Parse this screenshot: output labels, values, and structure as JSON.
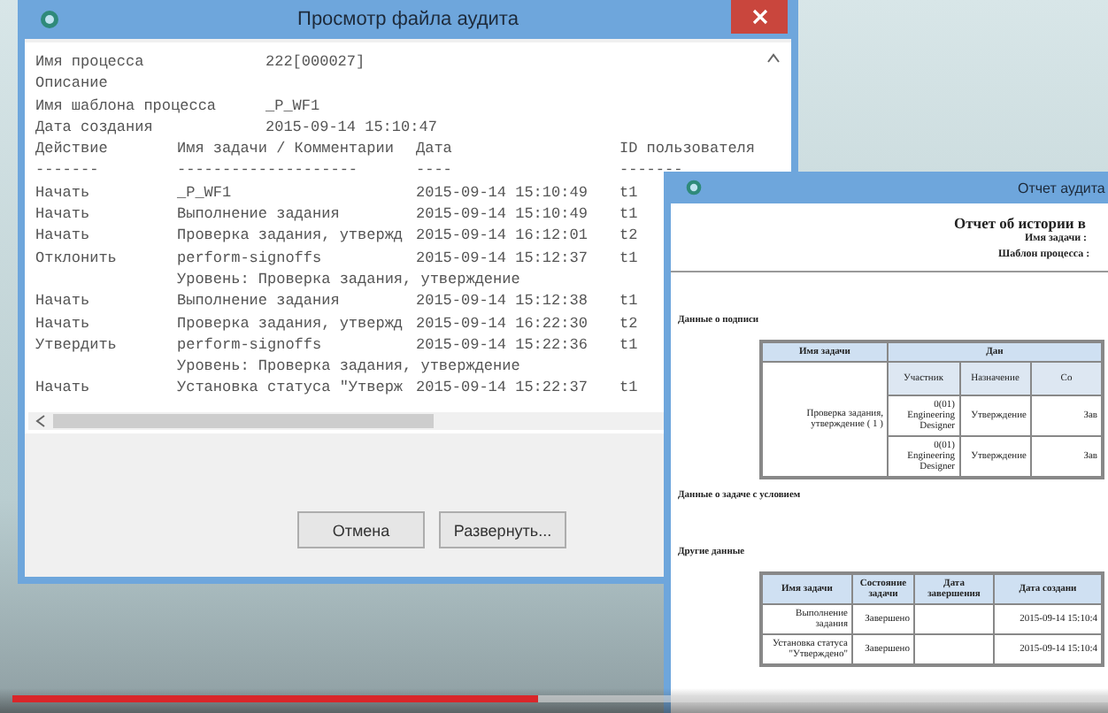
{
  "audit_window": {
    "title": "Просмотр файла аудита",
    "info": [
      {
        "label": "Имя процесса",
        "value": "222[000027]"
      },
      {
        "label": "Описание"
      },
      {
        "label": "Имя шаблона процесса",
        "value": "_P_WF1"
      },
      {
        "label": "Дата создания",
        "value": "2015-09-14 15:10:47"
      }
    ],
    "columns": [
      "Действие",
      "Имя задачи / Комментарии",
      "Дата",
      "ID пользователя"
    ],
    "separators": [
      "-------",
      "--------------------",
      "----",
      "-------"
    ],
    "rows": [
      {
        "kind": "action",
        "action": "Начать",
        "task": "_P_WF1",
        "date": "2015-09-14 15:10:49",
        "user": "t1"
      },
      {
        "kind": "action",
        "action": "Начать",
        "task": "Выполнение задания",
        "date": "2015-09-14 15:10:49",
        "user": "t1"
      },
      {
        "kind": "action",
        "action": "Начать",
        "task": "Проверка задания, утвержд",
        "date": "2015-09-14 16:12:01",
        "user": "t2"
      },
      {
        "kind": "action",
        "action": "Отклонить",
        "task": "perform-signoffs",
        "date": "2015-09-14 15:12:37",
        "user": "t1"
      },
      {
        "kind": "level",
        "text": "Уровень: Проверка задания, утверждение"
      },
      {
        "kind": "action",
        "action": "Начать",
        "task": "Выполнение задания",
        "date": "2015-09-14 15:12:38",
        "user": "t1"
      },
      {
        "kind": "action",
        "action": "Начать",
        "task": "Проверка задания, утвержд",
        "date": "2015-09-14 16:22:30",
        "user": "t2"
      },
      {
        "kind": "action",
        "action": "Утвердить",
        "task": "perform-signoffs",
        "date": "2015-09-14 15:22:36",
        "user": "t1"
      },
      {
        "kind": "level",
        "text": "Уровень: Проверка задания, утверждение"
      },
      {
        "kind": "action",
        "action": "Начать",
        "task": "Установка статуса \"Утверж",
        "date": "2015-09-14 15:22:37",
        "user": "t1"
      }
    ],
    "buttons": [
      "Отмена",
      "Развернуть..."
    ]
  },
  "report_window": {
    "title": "Отчет аудита",
    "heading": "Отчет об истории в",
    "fields": [
      "Имя задачи :",
      "Шаблон процесса :"
    ],
    "signature_section": "Данные о подписи",
    "signature_table": {
      "task_header": "Имя задачи",
      "data_header": "Дан",
      "sub_headers": [
        "Участник",
        "Назначение",
        "Со"
      ],
      "task": "Проверка задания, утверждение ( 1 )",
      "rows": [
        [
          "0(01) Engineering Designer",
          "Утверждение",
          "Зав"
        ],
        [
          "0(01) Engineering Designer",
          "Утверждение",
          "Зав"
        ]
      ]
    },
    "condition_section": "Данные о задаче с условием",
    "other_section": "Другие данные",
    "other_table": {
      "columns": [
        "Имя задачи",
        "Состояние задачи",
        "Дата завершения",
        "Дата создани"
      ],
      "rows": [
        [
          "Выполнение задания",
          "Завершено",
          "",
          "2015-09-14 15:10:4"
        ],
        [
          "Установка статуса \"Утверждено\"",
          "Завершено",
          "",
          "2015-09-14 15:10:4"
        ]
      ]
    }
  },
  "video_progress": {
    "level": 0.48
  }
}
